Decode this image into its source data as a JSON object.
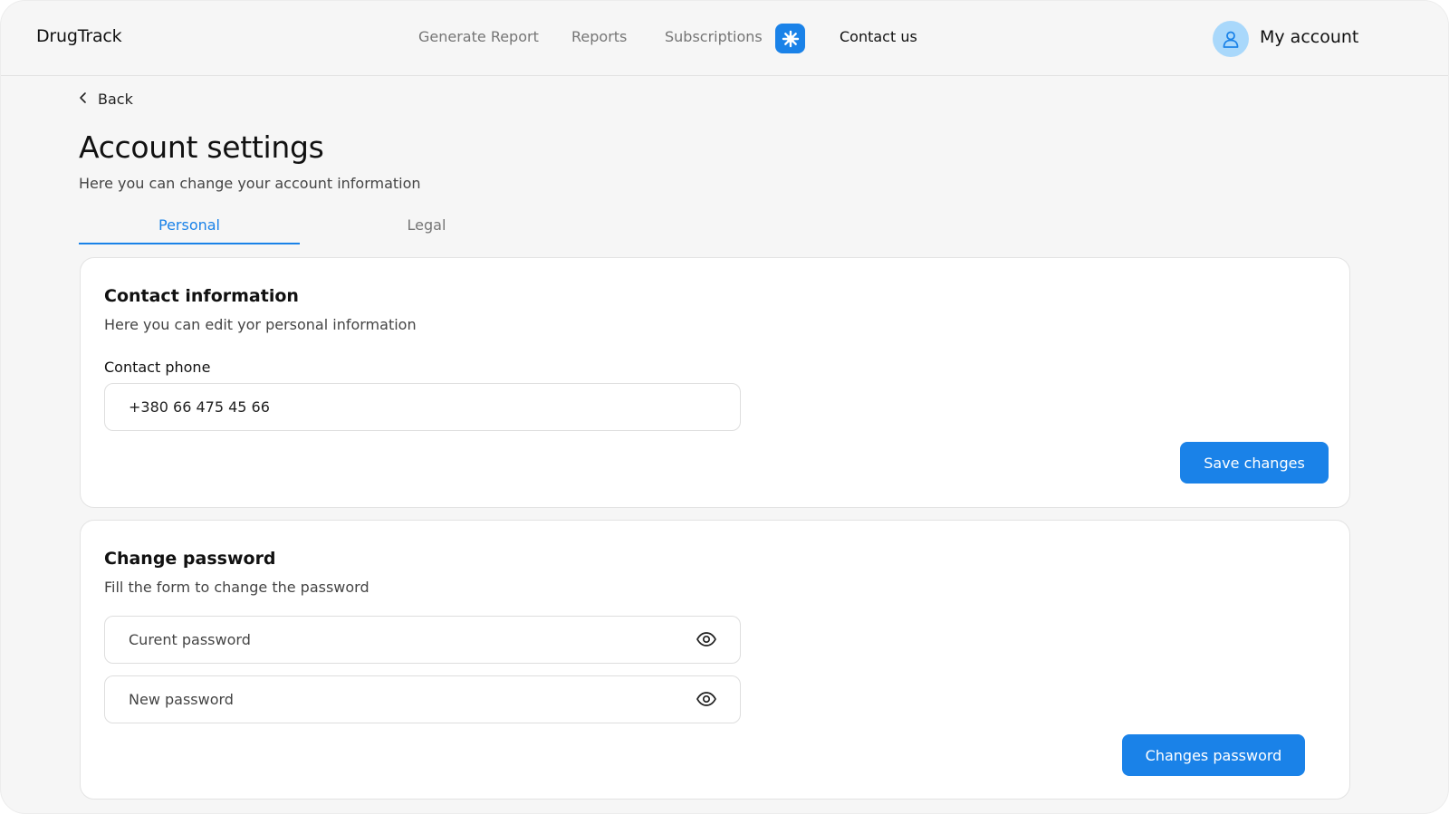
{
  "app": {
    "name": "DrugTrack"
  },
  "nav": {
    "generate_report": "Generate Report",
    "reports": "Reports",
    "subscriptions": "Subscriptions",
    "contact_us": "Contact us",
    "badge_icon": "sparkle-icon"
  },
  "account": {
    "label": "My account",
    "avatar_icon": "user-icon"
  },
  "back": {
    "label": "Back"
  },
  "page": {
    "title": "Account settings",
    "subtitle": "Here you can change your account information"
  },
  "tabs": [
    {
      "label": "Personal",
      "active": true
    },
    {
      "label": "Legal",
      "active": false
    }
  ],
  "contact_card": {
    "title": "Contact information",
    "subtitle": "Here you can edit yor personal information",
    "phone_label": "Contact phone",
    "phone_value": "+380 66 475 45 66",
    "save_label": "Save changes"
  },
  "password_card": {
    "title": "Change password",
    "subtitle": "Fill the form to change the password",
    "current_placeholder": "Curent password",
    "new_placeholder": "New password",
    "submit_label": "Changes password"
  },
  "colors": {
    "accent": "#1a82e8",
    "avatar_bg": "#a9d8fb",
    "page_bg": "#f6f6f6"
  }
}
